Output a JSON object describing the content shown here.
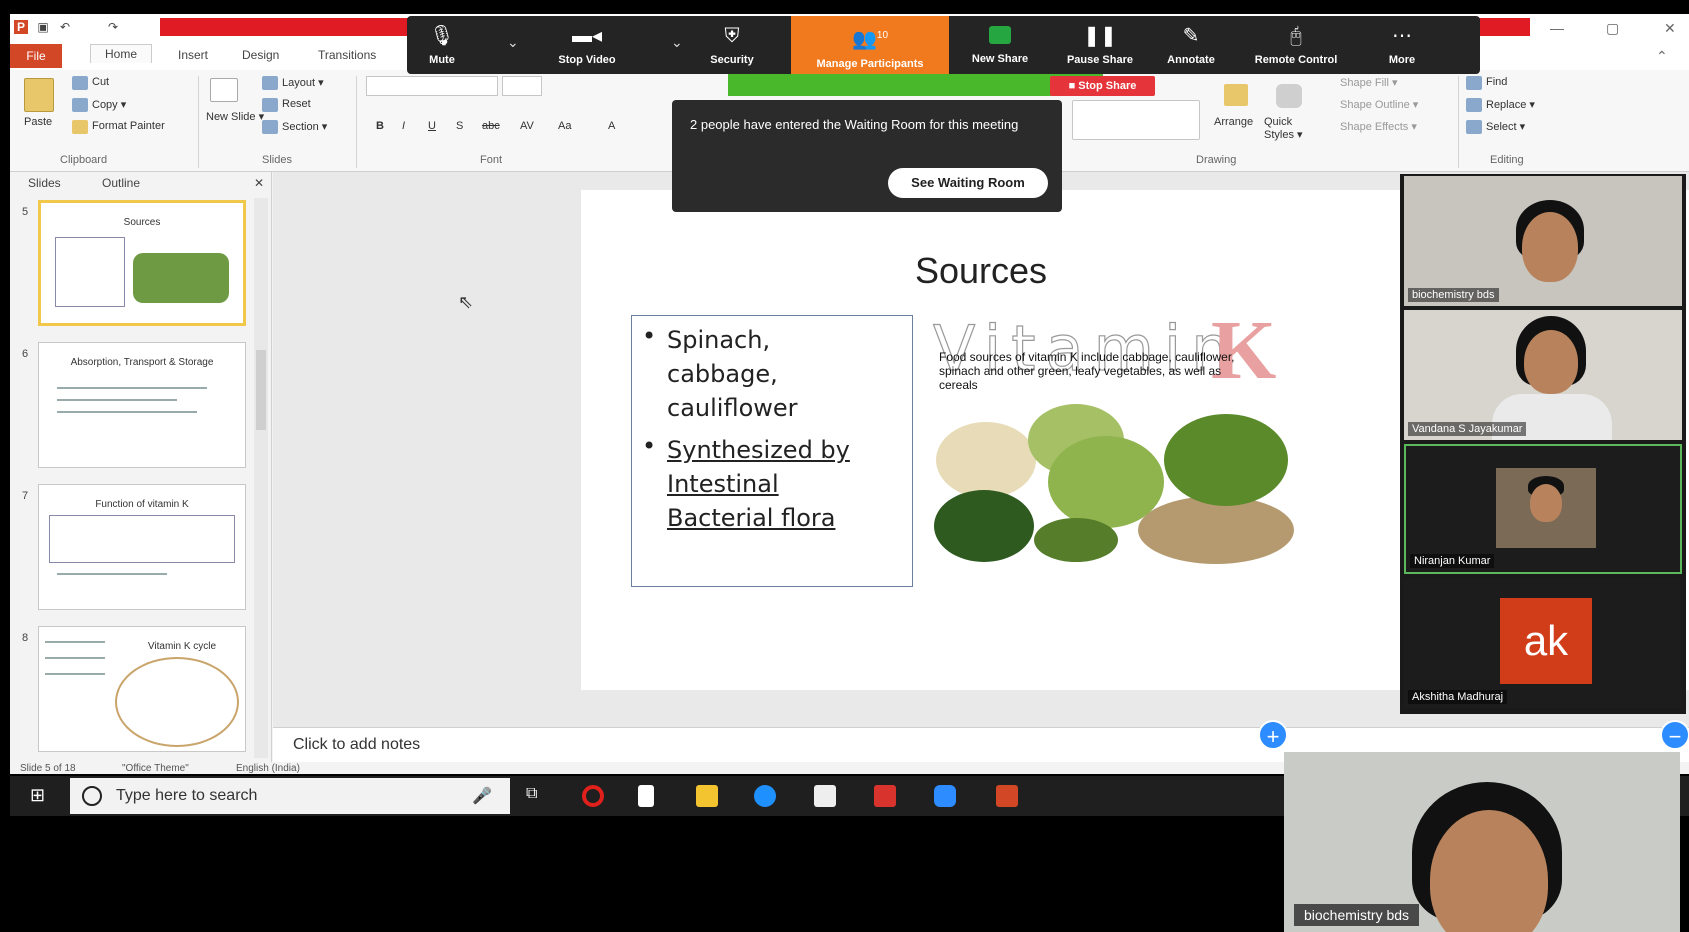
{
  "quick_access": {
    "icons": [
      "powerpoint-icon",
      "save-icon",
      "undo-icon",
      "redo-icon"
    ]
  },
  "ribbon_tabs": {
    "file": "File",
    "home": "Home",
    "insert": "Insert",
    "design": "Design",
    "transitions": "Transitions"
  },
  "ribbon": {
    "clipboard": {
      "paste": "Paste",
      "cut": "Cut",
      "copy": "Copy ▾",
      "format_painter": "Format Painter",
      "group": "Clipboard"
    },
    "slides": {
      "new_slide": "New Slide ▾",
      "layout": "Layout ▾",
      "reset": "Reset",
      "section": "Section ▾",
      "group": "Slides"
    },
    "font": {
      "group": "Font",
      "bold": "B",
      "italic": "I",
      "underline": "U",
      "shadow": "S",
      "strike": "abc",
      "spacing": "AV",
      "case": "Aa",
      "color": "A"
    },
    "drawing": {
      "arrange": "Arrange",
      "quick_styles": "Quick Styles ▾",
      "shape_fill": "Shape Fill ▾",
      "shape_outline": "Shape Outline ▾",
      "shape_effects": "Shape Effects ▾",
      "group": "Drawing"
    },
    "editing": {
      "find": "Find",
      "replace": "Replace ▾",
      "select": "Select ▾",
      "group": "Editing"
    }
  },
  "zoom_toolbar": {
    "mute": "Mute",
    "stop_video": "Stop Video",
    "security": "Security",
    "participants": "Manage Participants",
    "participants_count": "10",
    "new_share": "New Share",
    "pause_share": "Pause Share",
    "annotate": "Annotate",
    "remote_control": "Remote Control",
    "more": "More",
    "stop_share": "■ Stop Share"
  },
  "waiting_room": {
    "message": "2 people have entered the Waiting Room for this meeting",
    "button": "See Waiting Room"
  },
  "slides_pane": {
    "tab_slides": "Slides",
    "tab_outline": "Outline",
    "thumbs": [
      {
        "num": "5",
        "title": "Sources"
      },
      {
        "num": "6",
        "title": "Absorption, Transport & Storage"
      },
      {
        "num": "7",
        "title": "Function of vitamin K"
      },
      {
        "num": "8",
        "title": "Vitamin K cycle"
      }
    ]
  },
  "slide": {
    "title": "Sources",
    "bullets": [
      {
        "lines": [
          "Spinach,",
          "cabbage,",
          "cauliflower"
        ],
        "underline": false
      },
      {
        "lines": [
          "Synthesized by",
          "Intestinal",
          "Bacterial flora"
        ],
        "underline": true
      }
    ],
    "vitamin_word": "Vitamin",
    "vitamin_letter": "K",
    "vitamin_desc": "Food sources of vitamin K include cabbage, cauliflower, spinach and other green, leafy vegetables, as well as cereals"
  },
  "notes": {
    "placeholder": "Click to add notes"
  },
  "status": {
    "slide": "Slide 5 of 18",
    "theme": "\"Office Theme\"",
    "language": "English (India)"
  },
  "taskbar": {
    "search_placeholder": "Type here to search"
  },
  "gallery": {
    "tiles": [
      {
        "name": "biochemistry bds"
      },
      {
        "name": "Vandana S Jayakumar"
      },
      {
        "name": "Niranjan Kumar"
      },
      {
        "name": "Akshitha Madhuraj",
        "initials": "ak"
      }
    ]
  },
  "self_view": {
    "name": "biochemistry bds"
  },
  "colors": {
    "zoom_toolbar": "#242424",
    "participants_orange": "#f27a1e",
    "share_green": "#49b82b",
    "stop_share_red": "#e5343a",
    "ppt_file_tab": "#d24726",
    "avatar_orange": "#d13d19"
  }
}
